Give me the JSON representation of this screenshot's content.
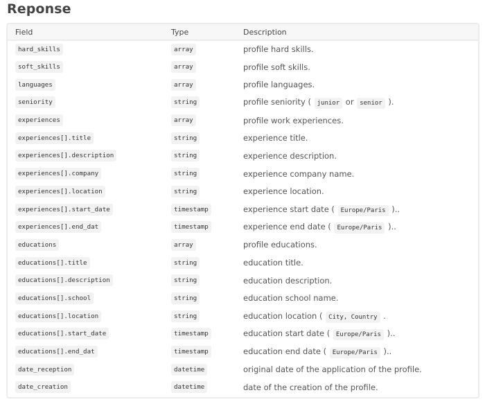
{
  "title": "Reponse",
  "table": {
    "headers": {
      "field": "Field",
      "type": "Type",
      "description": "Description"
    },
    "rows": [
      {
        "field": "hard_skills",
        "type": "array",
        "desc": [
          {
            "t": "profile hard skills."
          }
        ]
      },
      {
        "field": "soft_skills",
        "type": "array",
        "desc": [
          {
            "t": "profile soft skills."
          }
        ]
      },
      {
        "field": "languages",
        "type": "array",
        "desc": [
          {
            "t": "profile languages."
          }
        ]
      },
      {
        "field": "seniority",
        "type": "string",
        "desc": [
          {
            "t": "profile seniority ( "
          },
          {
            "code": "junior"
          },
          {
            "t": " or "
          },
          {
            "code": "senior"
          },
          {
            "t": " )."
          }
        ]
      },
      {
        "field": "experiences",
        "type": "array",
        "desc": [
          {
            "t": "profile work experiences."
          }
        ]
      },
      {
        "field": "experiences[].title",
        "type": "string",
        "desc": [
          {
            "t": "experience title."
          }
        ]
      },
      {
        "field": "experiences[].description",
        "type": "string",
        "desc": [
          {
            "t": "experience description."
          }
        ]
      },
      {
        "field": "experiences[].company",
        "type": "string",
        "desc": [
          {
            "t": "experience company name."
          }
        ]
      },
      {
        "field": "experiences[].location",
        "type": "string",
        "desc": [
          {
            "t": "experience location."
          }
        ]
      },
      {
        "field": "experiences[].start_date",
        "type": "timestamp",
        "desc": [
          {
            "t": "experience start date ( "
          },
          {
            "code": "Europe/Paris"
          },
          {
            "t": " ).."
          }
        ]
      },
      {
        "field": "experiences[].end_dat",
        "type": "timestamp",
        "desc": [
          {
            "t": "experience end date ( "
          },
          {
            "code": "Europe/Paris"
          },
          {
            "t": " ).."
          }
        ]
      },
      {
        "field": "educations",
        "type": "array",
        "desc": [
          {
            "t": "profile educations."
          }
        ]
      },
      {
        "field": "educations[].title",
        "type": "string",
        "desc": [
          {
            "t": "education title."
          }
        ]
      },
      {
        "field": "educations[].description",
        "type": "string",
        "desc": [
          {
            "t": "education description."
          }
        ]
      },
      {
        "field": "educations[].school",
        "type": "string",
        "desc": [
          {
            "t": "education school name."
          }
        ]
      },
      {
        "field": "educations[].location",
        "type": "string",
        "desc": [
          {
            "t": "education location ( "
          },
          {
            "code": "City, Country"
          },
          {
            "t": " ."
          }
        ]
      },
      {
        "field": "educations[].start_date",
        "type": "timestamp",
        "desc": [
          {
            "t": "education start date ( "
          },
          {
            "code": "Europe/Paris"
          },
          {
            "t": " ).."
          }
        ]
      },
      {
        "field": "educations[].end_dat",
        "type": "timestamp",
        "desc": [
          {
            "t": "education end date ( "
          },
          {
            "code": "Europe/Paris"
          },
          {
            "t": " ).."
          }
        ]
      },
      {
        "field": "date_reception",
        "type": "datetime",
        "desc": [
          {
            "t": "original date of the application of the profile."
          }
        ]
      },
      {
        "field": "date_creation",
        "type": "datetime",
        "desc": [
          {
            "t": "date of the creation of the profile."
          }
        ]
      }
    ]
  }
}
